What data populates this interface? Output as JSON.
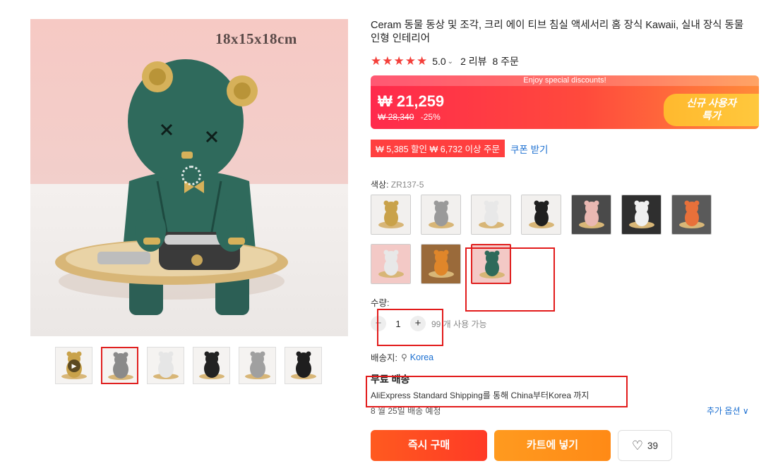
{
  "gallery": {
    "size_label": "18x15x18cm",
    "thumbnails": [
      {
        "name": "gold-bear-video",
        "color": "#c9a24a",
        "video": true,
        "active": false
      },
      {
        "name": "silver-bear",
        "color": "#8a8a8a",
        "video": false,
        "active": true
      },
      {
        "name": "white-bear",
        "color": "#e6e6e6",
        "video": false,
        "active": false
      },
      {
        "name": "black-bears-pair",
        "color": "#222222",
        "video": false,
        "active": false
      },
      {
        "name": "grey-bear",
        "color": "#a0a0a0",
        "video": false,
        "active": false
      },
      {
        "name": "black-bear",
        "color": "#1e1e1e",
        "video": false,
        "active": false
      }
    ]
  },
  "product": {
    "title": "Ceram 동물 동상 및 조각, 크리 에이 티브 침실 액세서리 홈 장식 Kawaii, 실내 장식 동물 인형 인테리어",
    "stars": "★★★★★",
    "score": "5.0",
    "reviews": "2 리뷰",
    "orders": "8 주문"
  },
  "price": {
    "ribbon": "Enjoy special discounts!",
    "current": "₩ 21,259",
    "original": "₩ 28,340",
    "discount": "-25%",
    "new_user_line1": "신규 사용자",
    "new_user_line2": "특가"
  },
  "coupon": {
    "label": "₩ 5,385 할인 ₩ 6,732 이상 주문",
    "link": "쿠폰 받기"
  },
  "color": {
    "label": "색상: ",
    "value": "ZR137-5",
    "swatches": [
      {
        "color": "#c9a24a",
        "bg": "#f2f0ee"
      },
      {
        "color": "#9a9a9a",
        "bg": "#f2f0ee"
      },
      {
        "color": "#e8e8e8",
        "bg": "#f2f0ee"
      },
      {
        "color": "#1f1f1f",
        "bg": "#f2f0ee"
      },
      {
        "color": "#e9b8b2",
        "bg": "#4a4a4a"
      },
      {
        "color": "#f0f0f0",
        "bg": "#2f2f2f"
      },
      {
        "color": "#e8703a",
        "bg": "#5a5a5a"
      },
      {
        "color": "#e8e8e8",
        "bg": "#f3c9c6"
      },
      {
        "color": "#e0862a",
        "bg": "#9a6a3a"
      },
      {
        "color": "#2f6a5a",
        "bg": "#f3c9c6",
        "selected": true
      }
    ]
  },
  "quantity": {
    "label": "수량:",
    "minus": "−",
    "value": "1",
    "plus": "+",
    "available": "99 개 사용 가능"
  },
  "shipping": {
    "label": "배송지:",
    "country": "Korea",
    "free": "무료 배송",
    "description": "AliExpress Standard Shipping를 통해 China부터Korea 까지",
    "date": "8 월 25일 배송 예정",
    "more_options": "추가 옵션 ∨"
  },
  "actions": {
    "buy_now": "즉시 구매",
    "add_to_cart": "카트에 넣기",
    "wishlist_count": "39"
  },
  "colors": {
    "accent_red": "#ff2a4c",
    "link_blue": "#1b6fd1",
    "annotation": "#e21b1b"
  }
}
